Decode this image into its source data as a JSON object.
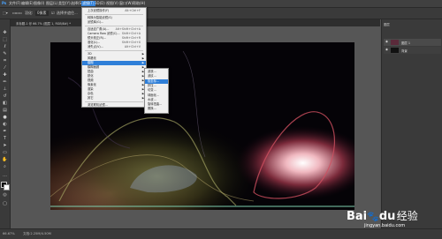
{
  "menubar": {
    "items": [
      "文件(F)",
      "编辑(E)",
      "图像(I)",
      "图层(L)",
      "类型(Y)",
      "选择(S)",
      "滤镜(T)",
      "3D(D)",
      "视图(V)",
      "窗口(W)",
      "帮助(H)"
    ]
  },
  "options": {
    "feather_label": "羽化:",
    "feather_value": "0像素",
    "select_label": "选择并遮住..."
  },
  "tab": {
    "title": "未标题-1 @ 66.7% (图层 1, RGB/8#) *"
  },
  "status": {
    "zoom": "66.67%",
    "doc": "文档:2.25M/4.50M"
  },
  "right_panel": {
    "header": "图层",
    "layer1": "图层 1",
    "layer2": "背景"
  },
  "filter_menu": {
    "items": [
      {
        "label": "上次滤镜操作(F)",
        "shortcut": "Alt+Ctrl+F"
      },
      {
        "label": "转换为智能滤镜(S)",
        "shortcut": ""
      },
      {
        "label": "滤镜库(G)...",
        "shortcut": ""
      },
      {
        "label": "自适应广角(A)...",
        "shortcut": "Alt+Shift+Ctrl+A"
      },
      {
        "label": "Camera Raw 滤镜(C)...",
        "shortcut": "Shift+Ctrl+A"
      },
      {
        "label": "镜头校正(R)...",
        "shortcut": "Shift+Ctrl+R"
      },
      {
        "label": "液化(L)...",
        "shortcut": "Shift+Ctrl+X"
      },
      {
        "label": "消失点(V)...",
        "shortcut": "Alt+Ctrl+V"
      },
      {
        "label": "3D",
        "shortcut": ""
      },
      {
        "label": "风格化",
        "shortcut": ""
      },
      {
        "label": "模糊",
        "shortcut": ""
      },
      {
        "label": "模糊画廊",
        "shortcut": ""
      },
      {
        "label": "扭曲",
        "shortcut": ""
      },
      {
        "label": "锐化",
        "shortcut": ""
      },
      {
        "label": "视频",
        "shortcut": ""
      },
      {
        "label": "像素化",
        "shortcut": ""
      },
      {
        "label": "渲染",
        "shortcut": ""
      },
      {
        "label": "杂色",
        "shortcut": ""
      },
      {
        "label": "其它",
        "shortcut": ""
      },
      {
        "label": "浏览联机滤镜...",
        "shortcut": ""
      }
    ]
  },
  "distort_submenu": {
    "items": [
      "波浪...",
      "波纹...",
      "极坐标...",
      "挤压...",
      "切变...",
      "球面化...",
      "水波...",
      "旋转扭曲...",
      "置换..."
    ],
    "highlighted_index": 2
  },
  "watermark": {
    "brand": "Bai",
    "paw": "du",
    "sub": "经验",
    "url": "jingyan.baidu.com"
  },
  "colors": {
    "highlight": "#2f7fd8",
    "ui_dark": "#3a3a3a"
  }
}
